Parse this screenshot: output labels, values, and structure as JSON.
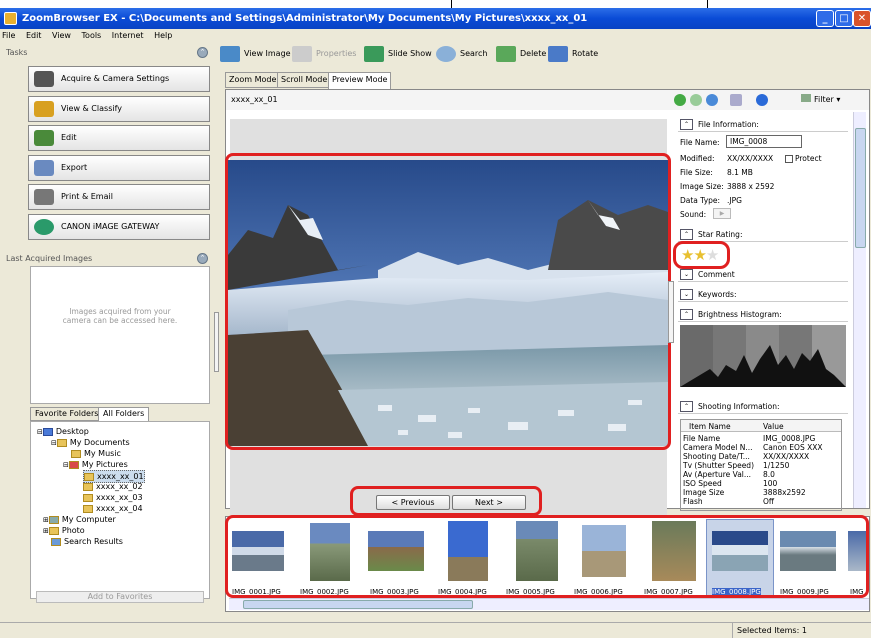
{
  "window": {
    "title": "ZoomBrowser EX  -  C:\\Documents and Settings\\Administrator\\My Documents\\My Pictures\\xxxx_xx_01",
    "minimize": "_",
    "maximize": "□",
    "close": "✕"
  },
  "menu": [
    "File",
    "Edit",
    "View",
    "Tools",
    "Internet",
    "Help"
  ],
  "tasks": {
    "title": "Tasks",
    "items": [
      "Acquire & Camera Settings",
      "View & Classify",
      "Edit",
      "Export",
      "Print & Email",
      "CANON iMAGE GATEWAY"
    ]
  },
  "last_acquired": {
    "title": "Last Acquired Images",
    "message": "Images acquired from your camera can be accessed here."
  },
  "folder_tabs": [
    "Favorite Folders",
    "All Folders"
  ],
  "tree": [
    "Desktop",
    "My Documents",
    "My Music",
    "My Pictures",
    "xxxx_xx_01",
    "xxxx_xx_02",
    "xxxx_xx_03",
    "xxxx_xx_04",
    "My Computer",
    "Photo",
    "Search Results"
  ],
  "add_favorites": "Add to Favorites",
  "toolbar": [
    "View Image",
    "Properties",
    "Slide Show",
    "Search",
    "Delete",
    "Rotate"
  ],
  "mode_tabs": [
    "Zoom Mode",
    "Scroll Mode",
    "Preview Mode"
  ],
  "view": {
    "folder": "xxxx_xx_01",
    "filter": "Filter"
  },
  "nav": {
    "previous": "< Previous",
    "next": "Next >"
  },
  "file_info": {
    "header": "File Information:",
    "name_label": "File Name:",
    "name_value": "IMG_0008",
    "modified_label": "Modified:",
    "modified_value": "XX/XX/XXXX",
    "protect_label": "Protect",
    "size_label": "File Size:",
    "size_value": "8.1 MB",
    "imgsize_label": "Image Size:",
    "imgsize_value": "3888 x 2592",
    "type_label": "Data Type:",
    "type_value": ".JPG",
    "sound_label": "Sound:"
  },
  "rating": {
    "header": "Star Rating:",
    "stars": 2,
    "max_stars": 3
  },
  "comment": "Comment",
  "keywords": "Keywords:",
  "histogram": "Brightness Histogram:",
  "shooting": {
    "header": "Shooting Information:",
    "col_name": "Item Name",
    "col_value": "Value",
    "rows": [
      [
        "File Name",
        "IMG_0008.JPG"
      ],
      [
        "Camera Model N...",
        "Canon EOS XXX"
      ],
      [
        "Shooting Date/T...",
        "XX/XX/XXXX"
      ],
      [
        "Tv (Shutter Speed)",
        "1/1250"
      ],
      [
        "Av (Aperture Val...",
        "8.0"
      ],
      [
        "ISO Speed",
        "100"
      ],
      [
        "Image Size",
        "3888x2592"
      ],
      [
        "Flash",
        "Off"
      ]
    ]
  },
  "thumbnails": [
    "IMG_0001.JPG",
    "IMG_0002.JPG",
    "IMG_0003.JPG",
    "IMG_0004.JPG",
    "IMG_0005.JPG",
    "IMG_0006.JPG",
    "IMG_0007.JPG",
    "IMG_0008.JPG",
    "IMG_0009.JPG",
    "IMG"
  ],
  "selected_thumbnail": 7,
  "status": "Selected Items: 1"
}
